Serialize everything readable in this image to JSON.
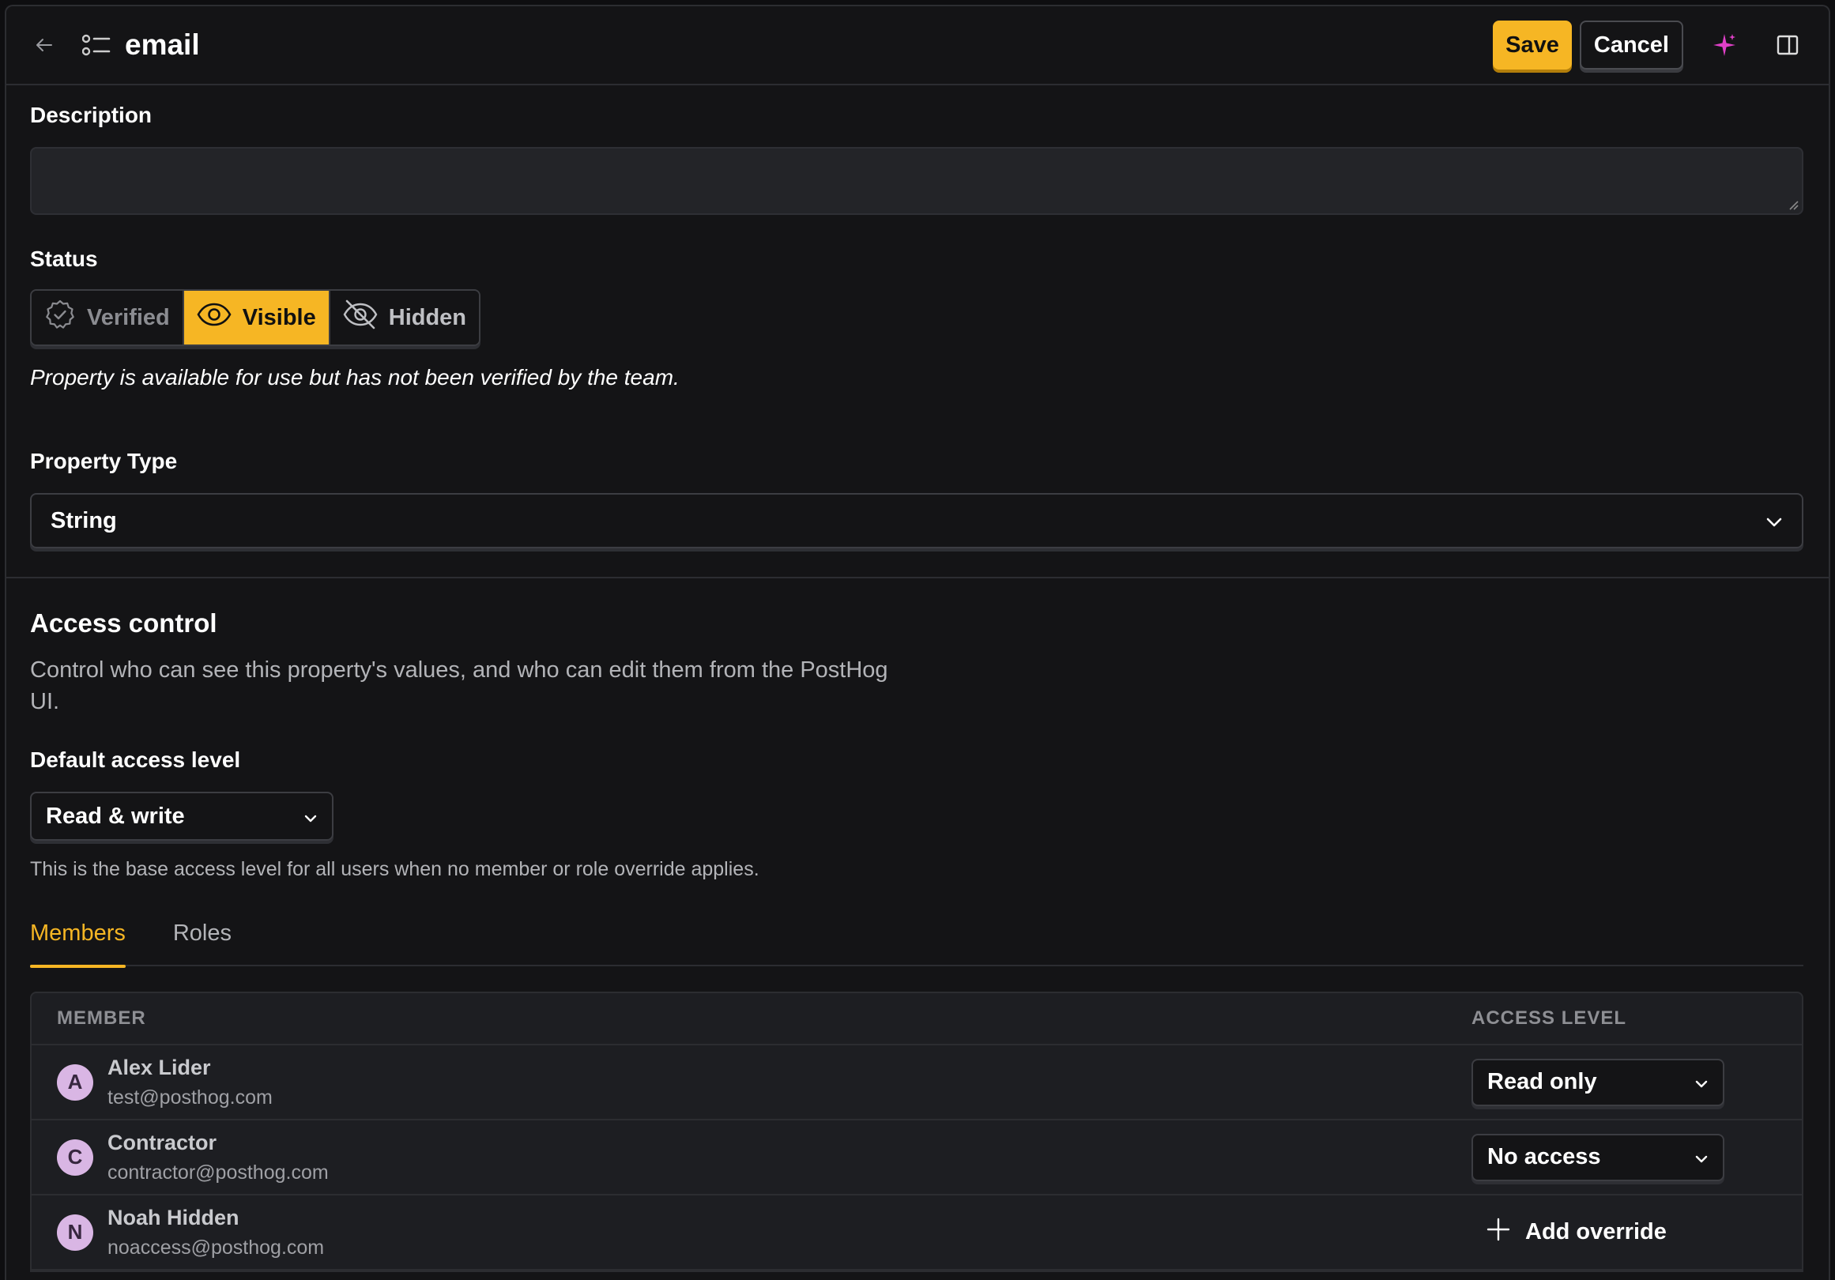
{
  "header": {
    "title": "email",
    "save_label": "Save",
    "cancel_label": "Cancel"
  },
  "description": {
    "label": "Description",
    "value": "",
    "placeholder": ""
  },
  "status": {
    "label": "Status",
    "options": [
      {
        "label": "Verified",
        "icon": "verified-badge-icon",
        "selected": false
      },
      {
        "label": "Visible",
        "icon": "eye-icon",
        "selected": true
      },
      {
        "label": "Hidden",
        "icon": "eye-off-icon",
        "selected": false
      }
    ],
    "hint": "Property is available for use but has not been verified by the team."
  },
  "property_type": {
    "label": "Property Type",
    "value": "String"
  },
  "access_control": {
    "title": "Access control",
    "description": "Control who can see this property's values, and who can edit them from the PostHog UI.",
    "default_label": "Default access level",
    "default_value": "Read & write",
    "default_hint": "This is the base access level for all users when no member or role override applies."
  },
  "tabs": [
    {
      "label": "Members",
      "active": true
    },
    {
      "label": "Roles",
      "active": false
    }
  ],
  "members_table": {
    "col_member": "MEMBER",
    "col_access": "ACCESS LEVEL",
    "rows": [
      {
        "initial": "A",
        "name": "Alex Lider",
        "email": "test@posthog.com",
        "access": "Read only"
      },
      {
        "initial": "C",
        "name": "Contractor",
        "email": "contractor@posthog.com",
        "access": "No access"
      },
      {
        "initial": "N",
        "name": "Noah Hidden",
        "email": "noaccess@posthog.com",
        "access": "Add override"
      }
    ]
  },
  "colors": {
    "accent": "#f6b624",
    "background": "#141416",
    "avatar": "#d9b6e4",
    "sparkle": "#e040c8"
  }
}
